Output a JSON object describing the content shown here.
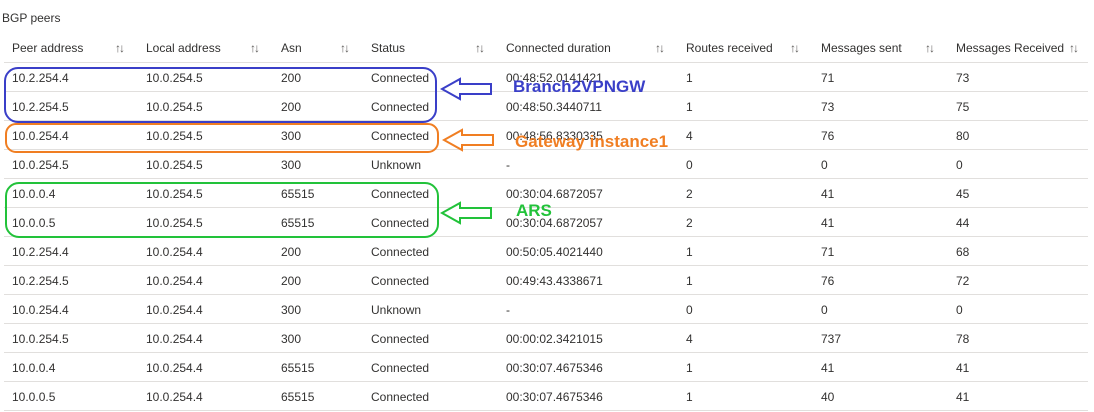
{
  "section_title": "BGP peers",
  "columns": [
    "Peer address",
    "Local address",
    "Asn",
    "Status",
    "Connected duration",
    "Routes received",
    "Messages sent",
    "Messages Received"
  ],
  "sort_icon": "sort-arrows-icon",
  "rows": [
    [
      "10.2.254.4",
      "10.0.254.5",
      "200",
      "Connected",
      "00:48:52.0141421",
      "1",
      "71",
      "73"
    ],
    [
      "10.2.254.5",
      "10.0.254.5",
      "200",
      "Connected",
      "00:48:50.3440711",
      "1",
      "73",
      "75"
    ],
    [
      "10.0.254.4",
      "10.0.254.5",
      "300",
      "Connected",
      "00:48:56.8330335",
      "4",
      "76",
      "80"
    ],
    [
      "10.0.254.5",
      "10.0.254.5",
      "300",
      "Unknown",
      "-",
      "0",
      "0",
      "0"
    ],
    [
      "10.0.0.4",
      "10.0.254.5",
      "65515",
      "Connected",
      "00:30:04.6872057",
      "2",
      "41",
      "45"
    ],
    [
      "10.0.0.5",
      "10.0.254.5",
      "65515",
      "Connected",
      "00:30:04.6872057",
      "2",
      "41",
      "44"
    ],
    [
      "10.2.254.4",
      "10.0.254.4",
      "200",
      "Connected",
      "00:50:05.4021440",
      "1",
      "71",
      "68"
    ],
    [
      "10.2.254.5",
      "10.0.254.4",
      "200",
      "Connected",
      "00:49:43.4338671",
      "1",
      "76",
      "72"
    ],
    [
      "10.0.254.4",
      "10.0.254.4",
      "300",
      "Unknown",
      "-",
      "0",
      "0",
      "0"
    ],
    [
      "10.0.254.5",
      "10.0.254.4",
      "300",
      "Connected",
      "00:00:02.3421015",
      "4",
      "737",
      "78"
    ],
    [
      "10.0.0.4",
      "10.0.254.4",
      "65515",
      "Connected",
      "00:30:07.4675346",
      "1",
      "41",
      "41"
    ],
    [
      "10.0.0.5",
      "10.0.254.4",
      "65515",
      "Connected",
      "00:30:07.4675346",
      "1",
      "40",
      "41"
    ]
  ],
  "annotations": [
    {
      "label": "Branch2VPNGW",
      "color": "#3a3fc8"
    },
    {
      "label": "Gateway instance1",
      "color": "#f07e22"
    },
    {
      "label": "ARS",
      "color": "#22c23a"
    }
  ]
}
